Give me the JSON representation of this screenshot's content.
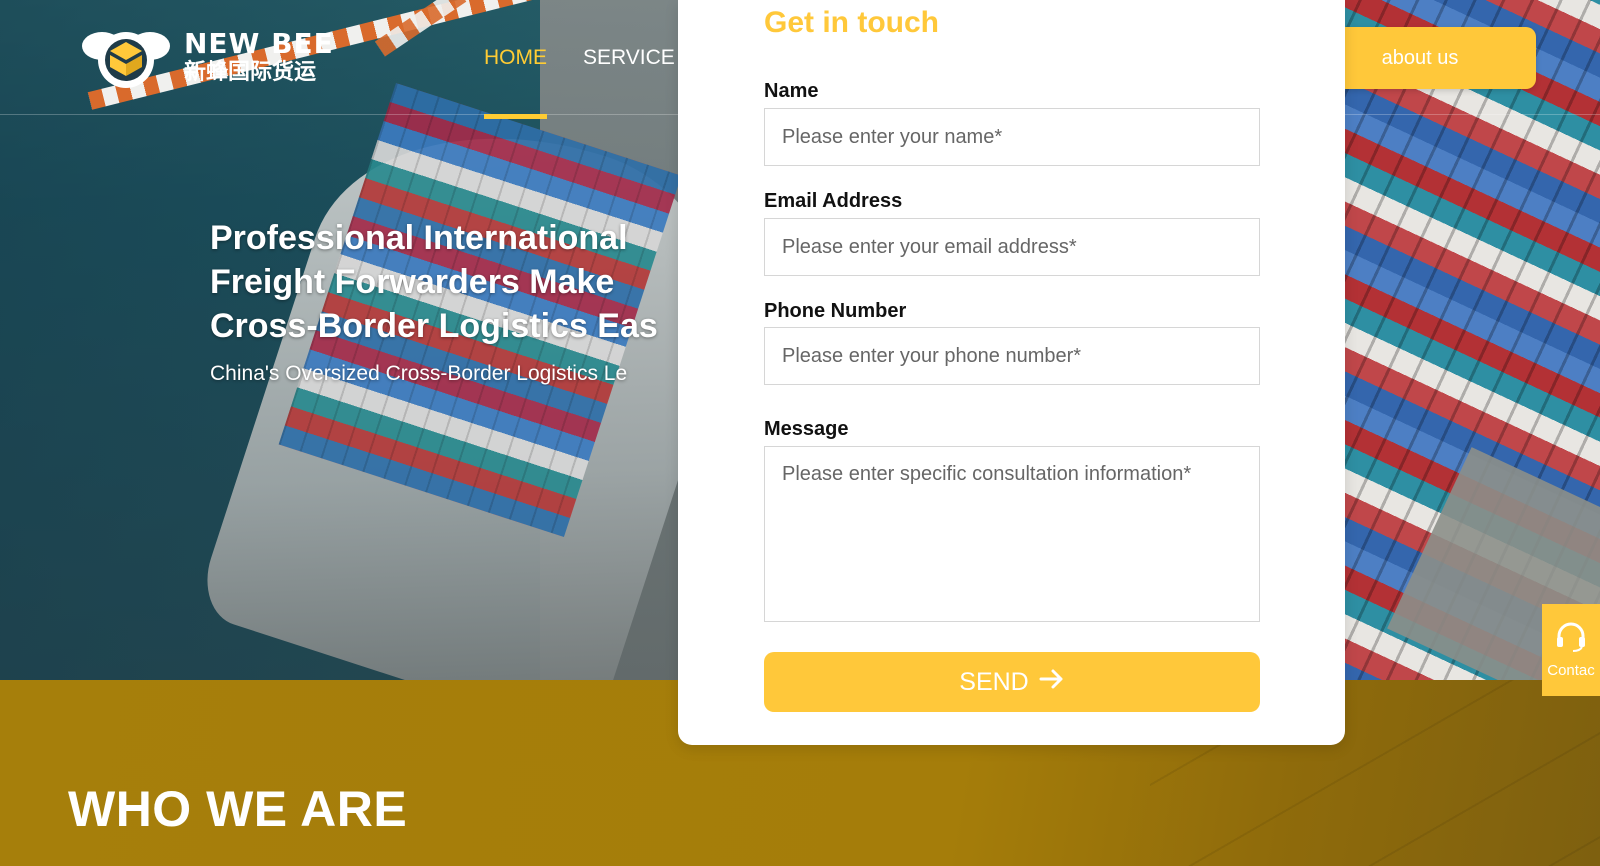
{
  "brand": {
    "name_en": "NEW BEE",
    "name_cn": "新蜂国际货运",
    "accent_color": "#ffc83a"
  },
  "nav": {
    "items": [
      {
        "label": "HOME",
        "active": true
      },
      {
        "label": "SERVICE",
        "active": false
      }
    ]
  },
  "header": {
    "about_label": "about us"
  },
  "hero": {
    "title_lines": [
      "Professional International",
      "Freight Forwarders Make",
      "Cross-Border Logistics Eas"
    ],
    "subtitle": "China's Oversized Cross-Border Logistics Le"
  },
  "form": {
    "title": "Get in touch",
    "name_label": "Name",
    "name_placeholder": "Please enter your name*",
    "email_label": "Email Address",
    "email_placeholder": "Please enter your email address*",
    "phone_label": "Phone Number",
    "phone_placeholder": "Please enter your phone number*",
    "message_label": "Message",
    "message_placeholder": "Please enter specific consultation information*",
    "send_label": "SEND"
  },
  "section": {
    "who_title": "WHO WE ARE"
  },
  "float": {
    "contact_label": "Contac"
  }
}
